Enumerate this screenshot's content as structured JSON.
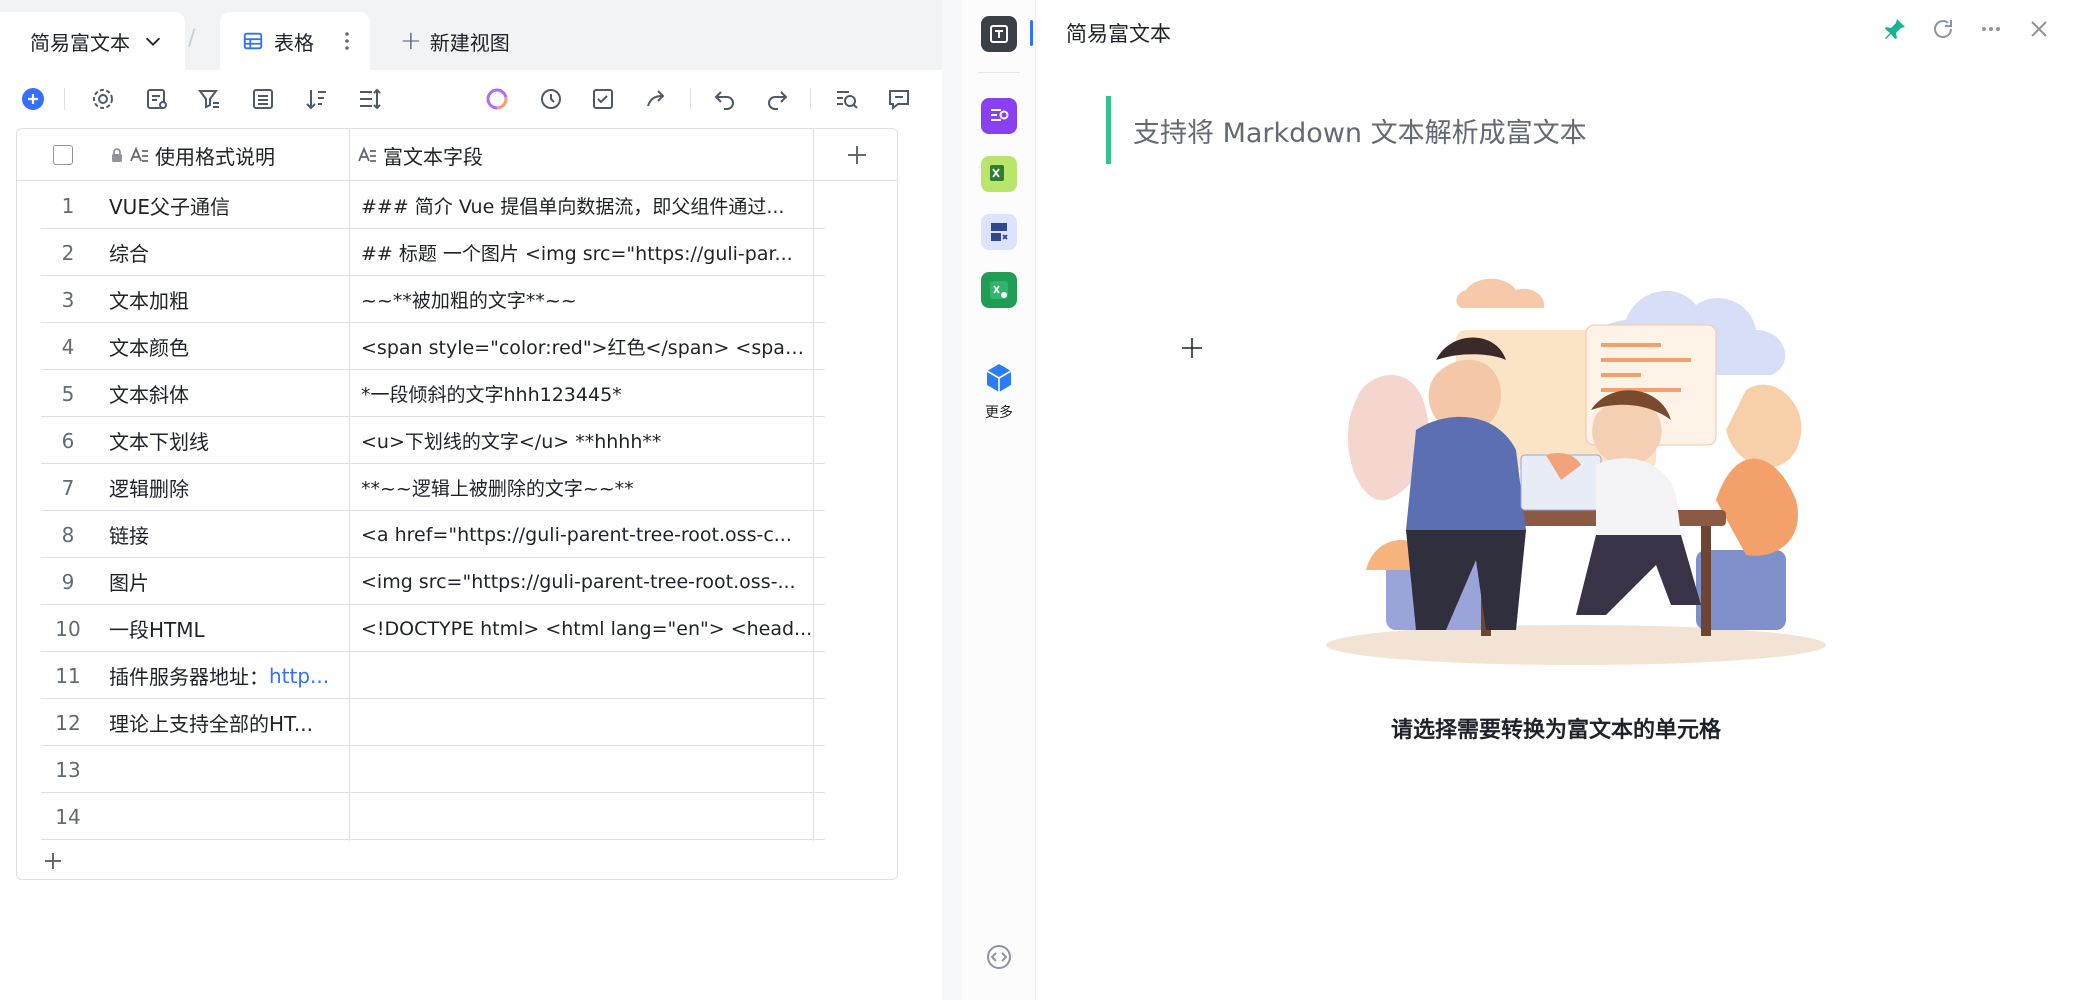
{
  "header": {
    "doc_name": "简易富文本",
    "active_view": "表格",
    "new_view": "新建视图"
  },
  "grid": {
    "columns": [
      "使用格式说明",
      "富文本字段"
    ],
    "rows": [
      {
        "num": "1",
        "c1": "VUE父子通信",
        "c2": "### 简介 Vue 提倡单向数据流，即父组件通过..."
      },
      {
        "num": "2",
        "c1": "综合",
        "c2": "## 标题 一个图片 <img src=\"https://guli-par..."
      },
      {
        "num": "3",
        "c1": "文本加粗",
        "c2": "~~**被加粗的文字**~~"
      },
      {
        "num": "4",
        "c1": "文本颜色",
        "c2": "<span style=\"color:red\">红色</span> <span..."
      },
      {
        "num": "5",
        "c1": "文本斜体",
        "c2": "*一段倾斜的文字hhh123445*"
      },
      {
        "num": "6",
        "c1": "文本下划线",
        "c2": "<u>下划线的文字</u> **hhhh**"
      },
      {
        "num": "7",
        "c1": "逻辑删除",
        "c2": "**~~逻辑上被删除的文字~~**"
      },
      {
        "num": "8",
        "c1": "链接",
        "c2": "<a href=\"https://guli-parent-tree-root.oss-c..."
      },
      {
        "num": "9",
        "c1": "图片",
        "c2": "<img src=\"https://guli-parent-tree-root.oss-..."
      },
      {
        "num": "10",
        "c1": "一段HTML",
        "c2": "<!DOCTYPE html> <html lang=\"en\"> <head..."
      },
      {
        "num": "11",
        "c1": "插件服务器地址：",
        "c1_link": "http...",
        "c2": ""
      },
      {
        "num": "12",
        "c1": "理论上支持全部的HT...",
        "c2": ""
      },
      {
        "num": "13",
        "c1": "",
        "c2": ""
      },
      {
        "num": "14",
        "c1": "",
        "c2": ""
      }
    ]
  },
  "sidebar": {
    "more_label": "更多"
  },
  "plugin": {
    "title": "简易富文本",
    "quote": "支持将 Markdown 文本解析成富文本",
    "hint": "请选择需要转换为富文本的单元格"
  },
  "colors": {
    "accent": "#3370ff",
    "quote_bar": "#34c38f",
    "pin": "#1ab394"
  },
  "icons": [
    "chevron-down-icon",
    "grid-view-icon",
    "more-vertical-icon",
    "plus-icon",
    "add-record-icon",
    "settings-icon",
    "field-icon",
    "filter-icon",
    "group-icon",
    "sort-icon",
    "row-height-icon",
    "ai-icon",
    "history-icon",
    "checklist-icon",
    "share-icon",
    "undo-icon",
    "redo-icon",
    "search-icon",
    "comment-icon",
    "lock-icon",
    "text-field-icon",
    "pin-icon",
    "refresh-icon",
    "more-icon",
    "close-icon",
    "code-icon"
  ]
}
